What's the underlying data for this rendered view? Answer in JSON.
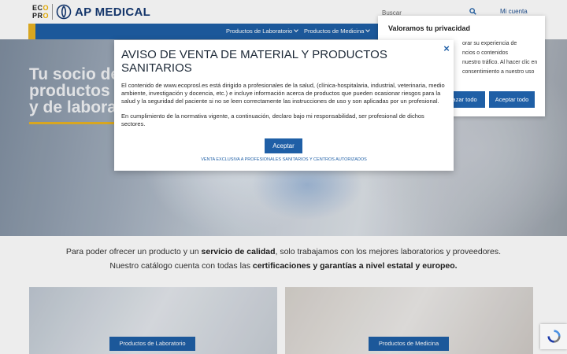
{
  "header": {
    "logo_eco": [
      "EC",
      "PR"
    ],
    "brand_name": "AP MEDICAL",
    "search_placeholder": "Buscar",
    "account_link": "Mi cuenta"
  },
  "nav": {
    "items": [
      {
        "label": "Productos de Laboratorio"
      },
      {
        "label": "Productos de Medicina"
      }
    ]
  },
  "hero": {
    "title_lines": [
      "Tu socio de",
      "productos m",
      "y de labora"
    ]
  },
  "intro": {
    "line1_pre": "Para poder ofrecer un producto y un ",
    "line1_bold": "servicio de calidad",
    "line1_post": ", solo trabajamos con los mejores laboratorios y proveedores.",
    "line2_pre": "Nuestro catálogo cuenta con todas las ",
    "line2_bold": "certificaciones y garantías a nivel estatal y europeo."
  },
  "categories": [
    {
      "button": "Productos de Laboratorio"
    },
    {
      "button": "Productos de Medicina"
    }
  ],
  "privacy_popup": {
    "title": "Valoramos tu privacidad",
    "text_lines": [
      "orar su experiencia de",
      "ncios o contenidos",
      "nuestro tráfico. Al hacer clic en",
      "consentimiento a nuestro uso"
    ],
    "reject_label": "nazar todo",
    "accept_label": "Aceptar todo"
  },
  "modal": {
    "title": "AVISO DE VENTA DE MATERIAL Y PRODUCTOS SANITARIOS",
    "paragraph1": "El contenido de www.ecoprosl.es está dirigido a profesionales de la salud, (clínica-hospitalaria, industrial, veterinaria, medio ambiente, investigación y docencia, etc.) e incluye información acerca de productos que pueden ocasionar riesgos para la salud y la seguridad del paciente si no se leen correctamente las instrucciones de uso y son aplicadas por un profesional.",
    "paragraph2": "En cumplimiento de la normativa vigente, a continuación, declaro bajo mi responsabilidad, ser profesional de dichos sectores.",
    "accept_label": "Aceptar",
    "footnote": "VENTA EXCLUSIVA A PROFESIONALES SANITARIOS Y CENTROS AUTORIZADOS",
    "close_icon": "×"
  },
  "colors": {
    "primary": "#1f5fa6",
    "accent": "#e9b323",
    "brand_navy": "#163a73"
  }
}
